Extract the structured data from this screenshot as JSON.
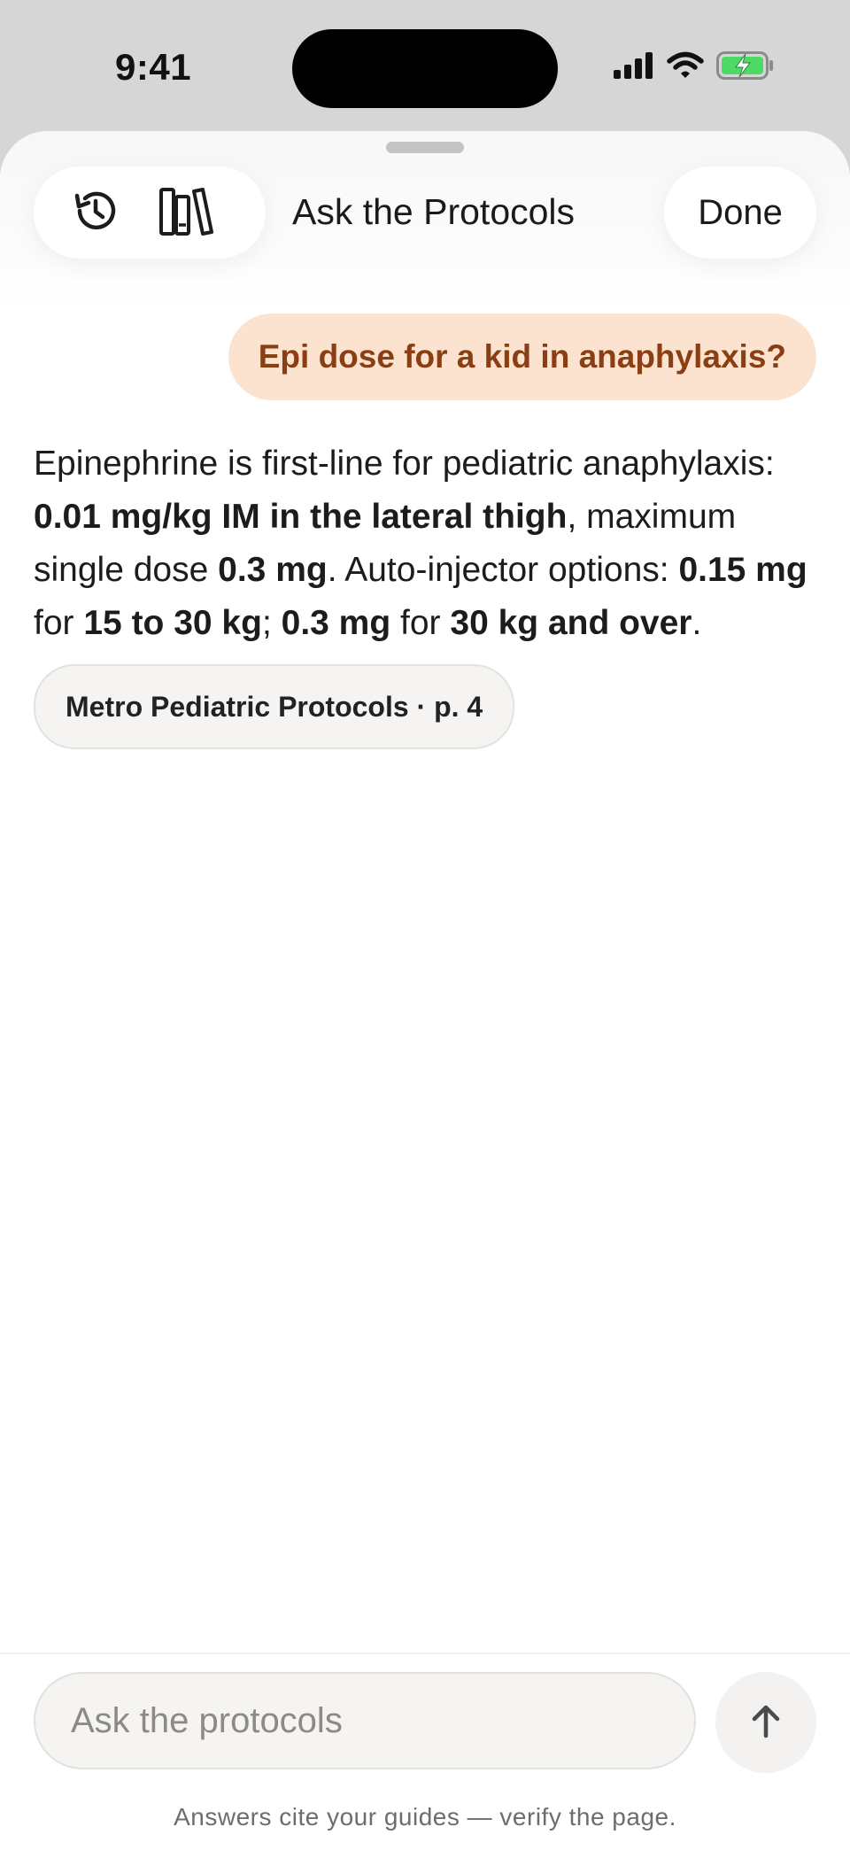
{
  "status_bar": {
    "time": "9:41"
  },
  "header": {
    "title": "Ask the Protocols",
    "done_label": "Done",
    "icons": [
      "history-icon",
      "library-icon"
    ]
  },
  "conversation": {
    "user_message": "Epi dose for a kid in anaphylaxis?",
    "answer": {
      "p1": "Epinephrine is first-line for pediatric anaphylaxis: ",
      "b1": "0.01 mg/kg IM in the lateral thigh",
      "p2": ", maximum single dose ",
      "b2": "0.3 mg",
      "p3": ". Auto-injector options: ",
      "b3": "0.15 mg",
      "p4": " for ",
      "b4": "15 to 30 kg",
      "p5": "; ",
      "b5": "0.3 mg",
      "p6": " for ",
      "b6": "30 kg and over",
      "p7": "."
    },
    "citation": "Metro Pediatric Protocols · p. 4"
  },
  "composer": {
    "placeholder": "Ask the protocols",
    "value": "",
    "send_icon": "arrow-up-icon",
    "footnote": "Answers cite your guides — verify the page."
  },
  "colors": {
    "user_bubble_bg": "#fbe3d0",
    "user_bubble_text": "#8a3e14",
    "battery_green": "#4cd964",
    "sheet_bg": "#ffffff",
    "backdrop": "#d6d6d6"
  }
}
